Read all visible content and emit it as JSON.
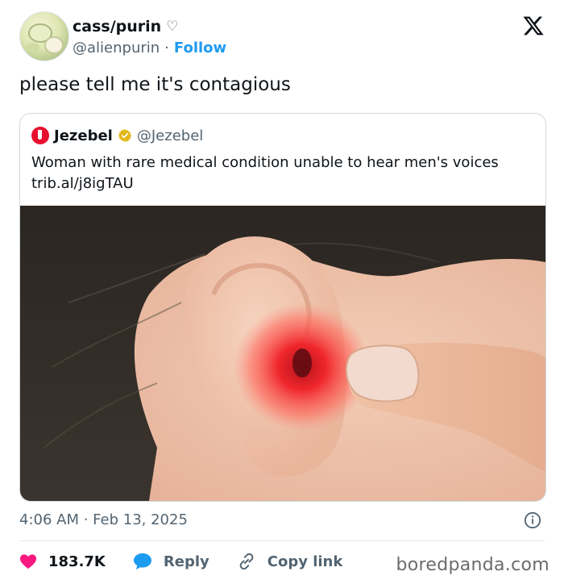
{
  "author": {
    "name": "cass/purin",
    "name_suffix": "♡",
    "handle": "@alienpurin",
    "separator": "·",
    "follow_label": "Follow"
  },
  "tweet": {
    "text": "please tell me it's contagious",
    "timestamp": "4:06 AM · Feb 13, 2025"
  },
  "quoted": {
    "name": "Jezebel",
    "handle": "@Jezebel",
    "text": "Woman with rare medical condition unable to hear men's voices",
    "link": "trib.al/j8igTAU"
  },
  "actions": {
    "likes": "183.7K",
    "reply_label": "Reply",
    "copy_label": "Copy link"
  },
  "watermark": "boredpanda.com",
  "colors": {
    "accent": "#1d9bf0",
    "like": "#f91880",
    "text": "#0f1419",
    "muted": "#536471",
    "brand_red": "#e8102e",
    "verified_gold": "#e2b719"
  }
}
